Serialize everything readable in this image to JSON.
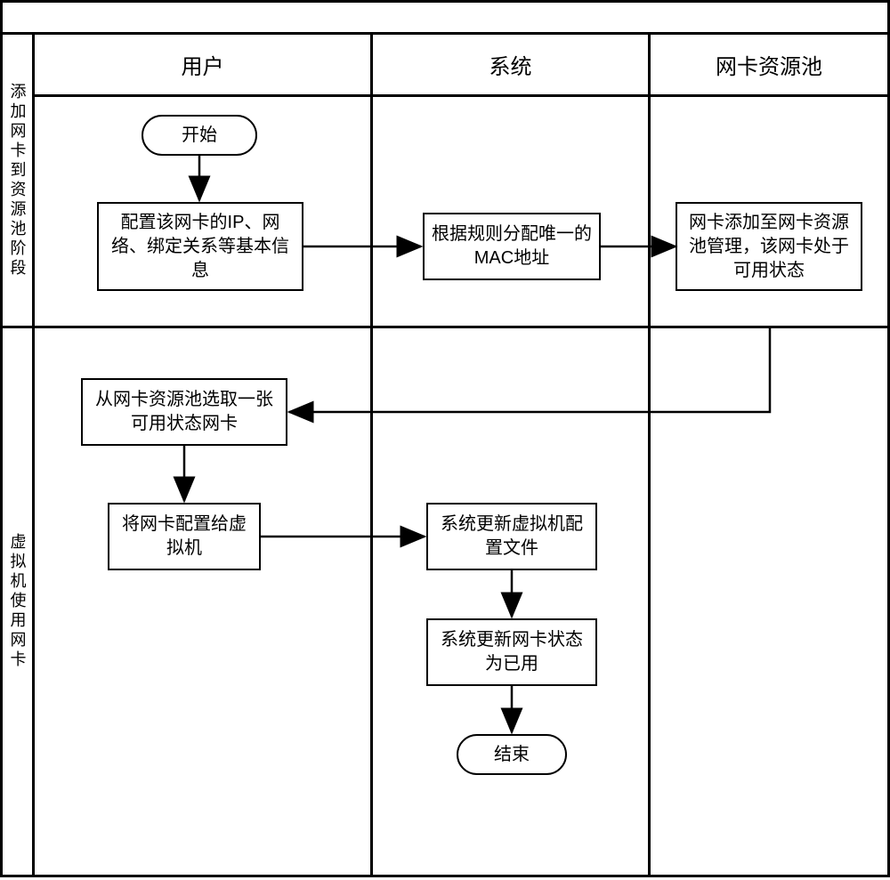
{
  "swimlane_rows": {
    "top": "添加网卡到资源池阶段",
    "bottom": "虚拟机使用网卡"
  },
  "swimlane_cols": {
    "user": "用户",
    "system": "系统",
    "pool": "网卡资源池"
  },
  "nodes": {
    "start": "开始",
    "configure_nic": "配置该网卡的IP、网络、绑定关系等基本信息",
    "assign_mac": "根据规则分配唯一的MAC地址",
    "add_to_pool": "网卡添加至网卡资源池管理，该网卡处于可用状态",
    "select_nic": "从网卡资源池选取一张可用状态网卡",
    "assign_to_vm": "将网卡配置给虚拟机",
    "update_vm_config": "系统更新虚拟机配置文件",
    "update_nic_state": "系统更新网卡状态为已用",
    "end": "结束"
  },
  "chart_data": {
    "type": "table",
    "description": "Swimlane flowchart: adding NIC to resource pool, then VM uses NIC",
    "columns": [
      "用户",
      "系统",
      "网卡资源池"
    ],
    "rows": [
      "添加网卡到资源池阶段",
      "虚拟机使用网卡"
    ],
    "flow": [
      {
        "id": "start",
        "lane": "用户",
        "row": "添加网卡到资源池阶段",
        "shape": "terminator",
        "text": "开始"
      },
      {
        "id": "configure_nic",
        "lane": "用户",
        "row": "添加网卡到资源池阶段",
        "shape": "process",
        "text": "配置该网卡的IP、网络、绑定关系等基本信息"
      },
      {
        "id": "assign_mac",
        "lane": "系统",
        "row": "添加网卡到资源池阶段",
        "shape": "process",
        "text": "根据规则分配唯一的MAC地址"
      },
      {
        "id": "add_to_pool",
        "lane": "网卡资源池",
        "row": "添加网卡到资源池阶段",
        "shape": "process",
        "text": "网卡添加至网卡资源池管理，该网卡处于可用状态"
      },
      {
        "id": "select_nic",
        "lane": "用户",
        "row": "虚拟机使用网卡",
        "shape": "process",
        "text": "从网卡资源池选取一张可用状态网卡"
      },
      {
        "id": "assign_to_vm",
        "lane": "用户",
        "row": "虚拟机使用网卡",
        "shape": "process",
        "text": "将网卡配置给虚拟机"
      },
      {
        "id": "update_vm_config",
        "lane": "系统",
        "row": "虚拟机使用网卡",
        "shape": "process",
        "text": "系统更新虚拟机配置文件"
      },
      {
        "id": "update_nic_state",
        "lane": "系统",
        "row": "虚拟机使用网卡",
        "shape": "process",
        "text": "系统更新网卡状态为已用"
      },
      {
        "id": "end",
        "lane": "系统",
        "row": "虚拟机使用网卡",
        "shape": "terminator",
        "text": "结束"
      }
    ],
    "edges": [
      [
        "start",
        "configure_nic"
      ],
      [
        "configure_nic",
        "assign_mac"
      ],
      [
        "assign_mac",
        "add_to_pool"
      ],
      [
        "add_to_pool",
        "select_nic"
      ],
      [
        "select_nic",
        "assign_to_vm"
      ],
      [
        "assign_to_vm",
        "update_vm_config"
      ],
      [
        "update_vm_config",
        "update_nic_state"
      ],
      [
        "update_nic_state",
        "end"
      ]
    ]
  }
}
